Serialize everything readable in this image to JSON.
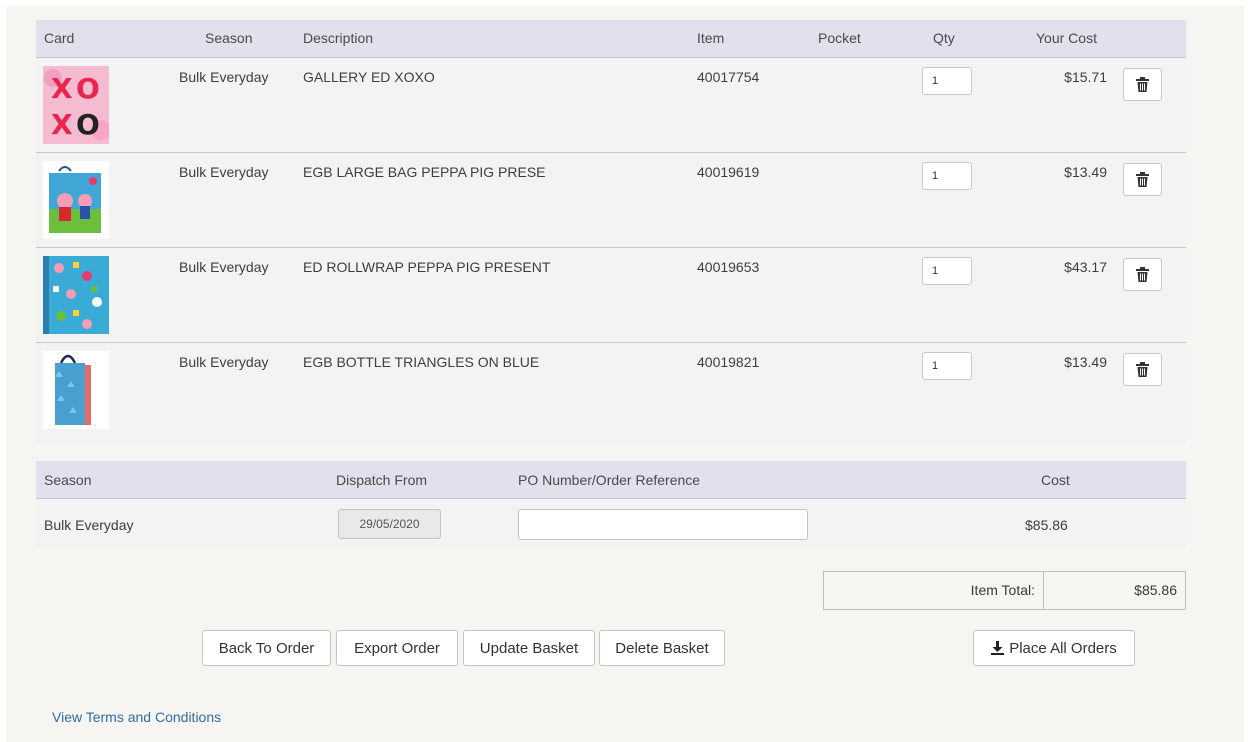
{
  "basket": {
    "headers": {
      "card": "Card",
      "season": "Season",
      "description": "Description",
      "item": "Item",
      "pocket": "Pocket",
      "qty": "Qty",
      "your_cost": "Your Cost"
    },
    "rows": [
      {
        "season": "Bulk Everyday",
        "description": "GALLERY ED XOXO",
        "item": "40017754",
        "pocket": "",
        "qty": "1",
        "cost": "$15.71",
        "thumb": "xoxo-card-icon"
      },
      {
        "season": "Bulk Everyday",
        "description": "EGB LARGE BAG PEPPA PIG PRESE",
        "item": "40019619",
        "pocket": "",
        "qty": "1",
        "cost": "$13.49",
        "thumb": "peppa-bag-icon"
      },
      {
        "season": "Bulk Everyday",
        "description": "ED ROLLWRAP PEPPA PIG PRESENT",
        "item": "40019653",
        "pocket": "",
        "qty": "1",
        "cost": "$43.17",
        "thumb": "peppa-wrap-icon"
      },
      {
        "season": "Bulk Everyday",
        "description": "EGB BOTTLE TRIANGLES ON BLUE",
        "item": "40019821",
        "pocket": "",
        "qty": "1",
        "cost": "$13.49",
        "thumb": "bottle-bag-icon"
      }
    ]
  },
  "season_table": {
    "headers": {
      "season": "Season",
      "dispatch_from": "Dispatch From",
      "po_number": "PO Number/Order Reference",
      "cost": "Cost"
    },
    "row": {
      "season": "Bulk Everyday",
      "dispatch_from": "29/05/2020",
      "po_value": "",
      "cost": "$85.86"
    }
  },
  "totals": {
    "label": "Item Total:",
    "value": "$85.86"
  },
  "buttons": {
    "back": "Back To Order",
    "export": "Export Order",
    "update": "Update Basket",
    "delete": "Delete Basket",
    "place_all": "Place All Orders"
  },
  "links": {
    "terms": "View Terms and Conditions"
  },
  "colors": {
    "header_bg": "#e4dfec",
    "link": "#2f6ea5",
    "page_bg": "#f6f5f1"
  }
}
